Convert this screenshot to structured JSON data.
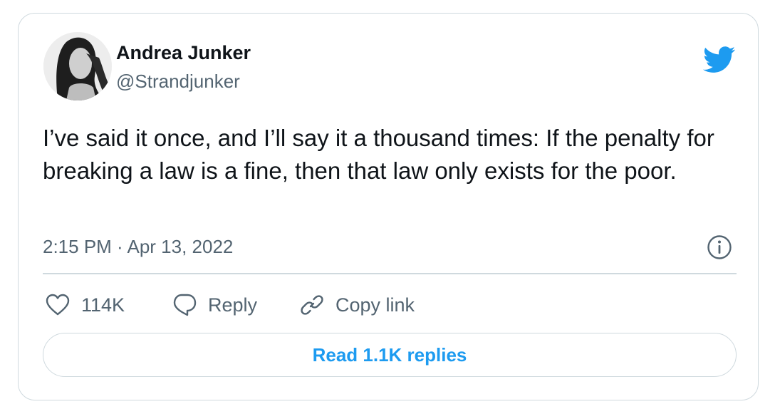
{
  "author": {
    "name": "Andrea Junker",
    "handle": "@Strandjunker"
  },
  "tweet": {
    "text": "I’ve said it once, and I’ll say it a thousand times: If the penalty for breaking a law is a fine, then that law only exists for the poor.",
    "timestamp": "2:15 PM · Apr 13, 2022"
  },
  "actions": {
    "likes": "114K",
    "reply_label": "Reply",
    "copy_link_label": "Copy link"
  },
  "replies_button_label": "Read 1.1K replies",
  "icons": {
    "brand": "twitter-bird-icon",
    "info": "info-icon",
    "like": "heart-icon",
    "reply": "speech-bubble-icon",
    "copy": "link-icon"
  },
  "colors": {
    "accent": "#1d9bf0",
    "secondary_text": "#536471",
    "border": "#cfd9de"
  }
}
